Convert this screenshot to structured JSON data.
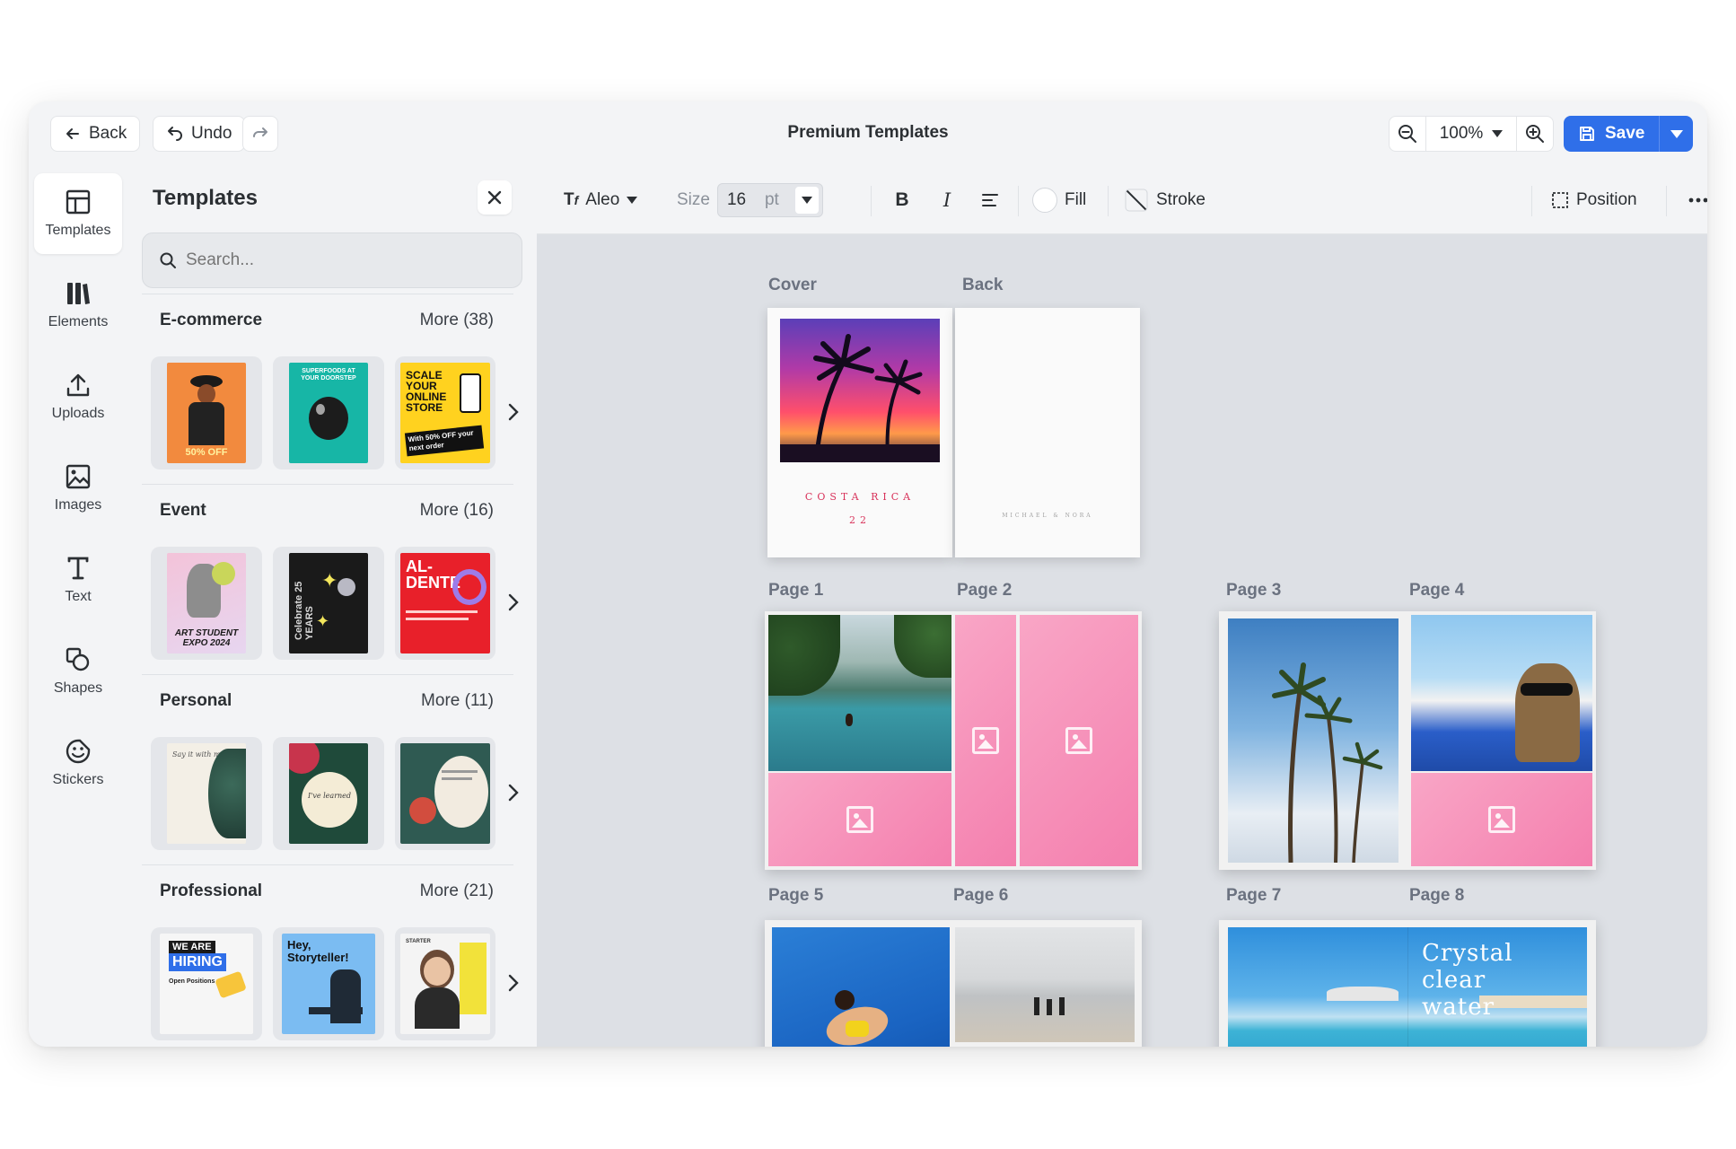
{
  "topbar": {
    "back_label": "Back",
    "undo_label": "Undo",
    "title": "Premium Templates",
    "zoom_value": "100%",
    "save_label": "Save"
  },
  "rail": {
    "items": [
      {
        "label": "Templates",
        "icon": "layout-icon"
      },
      {
        "label": "Elements",
        "icon": "elements-icon"
      },
      {
        "label": "Uploads",
        "icon": "upload-icon"
      },
      {
        "label": "Images",
        "icon": "image-icon"
      },
      {
        "label": "Text",
        "icon": "text-icon"
      },
      {
        "label": "Shapes",
        "icon": "shapes-icon"
      },
      {
        "label": "Stickers",
        "icon": "sticker-icon"
      }
    ]
  },
  "panel": {
    "title": "Templates",
    "search_placeholder": "Search...",
    "sections": [
      {
        "name": "E-commerce",
        "more": "More (38)"
      },
      {
        "name": "Event",
        "more": "More (16)"
      },
      {
        "name": "Personal",
        "more": "More (11)"
      },
      {
        "name": "Professional",
        "more": "More (21)"
      }
    ]
  },
  "thumbs": {
    "ecom1": {
      "line1": "50% OFF"
    },
    "ecom2": {
      "line1": "SUPERFOODS AT YOUR DOORSTEP"
    },
    "ecom3": {
      "line1": "SCALE YOUR ONLINE STORE",
      "line2": "With 50% OFF your next order"
    },
    "event1": {
      "line1": "ART STUDENT EXPO 2024"
    },
    "event2": {
      "line1": "Celebrate 25 YEARS"
    },
    "event3": {
      "line1": "AL-DENTE"
    },
    "personal1": {
      "line1": "Say it with me"
    },
    "personal2": {
      "line1": "I've learned"
    },
    "prof1": {
      "line1": "WE ARE",
      "line2": "HIRING",
      "line3": "Open Positions"
    },
    "prof2": {
      "line1": "Hey, Storyteller!"
    },
    "prof3": {
      "line1": "STARTER"
    }
  },
  "toolbar": {
    "font_name": "Aleo",
    "size_label": "Size",
    "size_value": "16",
    "size_unit": "pt",
    "fill_label": "Fill",
    "stroke_label": "Stroke",
    "position_label": "Position"
  },
  "canvas": {
    "labels": {
      "cover": "Cover",
      "back": "Back",
      "p1": "Page 1",
      "p2": "Page 2",
      "p3": "Page 3",
      "p4": "Page 4",
      "p5": "Page 5",
      "p6": "Page 6",
      "p7": "Page 7",
      "p8": "Page 8"
    },
    "cover_title": "COSTA RICA",
    "cover_year": "22",
    "back_text": "MICHAEL & NORA",
    "crystal_text": [
      "Crystal",
      "clear",
      "water"
    ]
  },
  "colors": {
    "accent": "#2f6fe9",
    "pink": "#f47fae"
  }
}
